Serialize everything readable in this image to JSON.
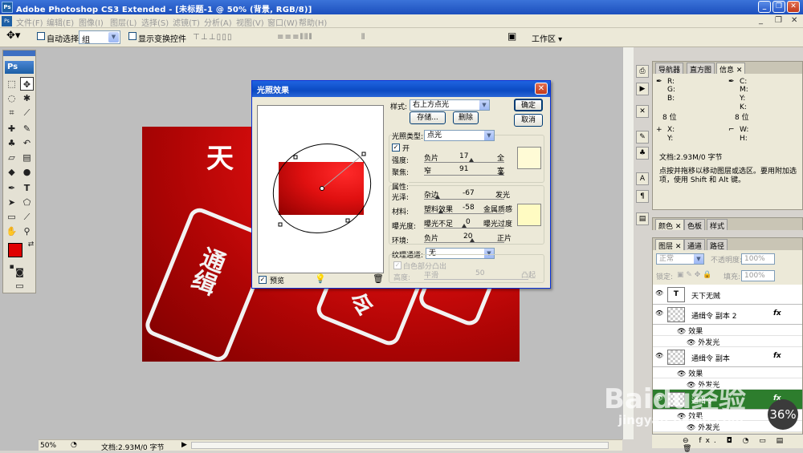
{
  "window": {
    "title": "Adobe Photoshop CS3 Extended - [未标题-1 @ 50% (背景, RGB/8)]",
    "app_icon": "Ps"
  },
  "menu": {
    "items": [
      "文件(F)",
      "编辑(E)",
      "图像(I)",
      "图层(L)",
      "选择(S)",
      "滤镜(T)",
      "分析(A)",
      "视图(V)",
      "窗口(W)",
      "帮助(H)"
    ]
  },
  "options": {
    "auto_select_label": "自动选择:",
    "auto_select_value": "组",
    "show_transform_label": "显示变换控件",
    "workspace_label": "工作区 ▾"
  },
  "toolbox": {
    "logo": "Ps"
  },
  "canvas": {
    "text_top": "天",
    "stamp_text_1": "通缉",
    "stamp_text_2": "令"
  },
  "status": {
    "zoom": "50%",
    "doc": "文档:2.93M/0 字节"
  },
  "dialog": {
    "title": "光照效果",
    "style_label": "样式:",
    "style_value": "右上方点光",
    "save_button": "存储...",
    "delete_button": "删除",
    "ok_button": "确定",
    "cancel_button": "取消",
    "light_type_label": "光照类型:",
    "light_type_value": "点光",
    "on_label": "开",
    "intensity": {
      "label": "强度:",
      "left": "负片",
      "value": "17",
      "right": "全"
    },
    "focus": {
      "label": "聚焦:",
      "left": "窄",
      "value": "91",
      "right": "宽"
    },
    "properties_label": "属性:",
    "gloss": {
      "label": "光泽:",
      "left": "杂边",
      "value": "-67",
      "right": "发光"
    },
    "material": {
      "label": "材料:",
      "left": "塑料效果",
      "value": "-58",
      "right": "金属质感"
    },
    "exposure": {
      "label": "曝光度:",
      "left": "曝光不足",
      "value": "0",
      "right": "曝光过度"
    },
    "ambience": {
      "label": "环境:",
      "left": "负片",
      "value": "20",
      "right": "正片"
    },
    "texture_label": "纹理通道:",
    "texture_value": "无",
    "white_high_label": "白色部分凸出",
    "height": {
      "label": "高度:",
      "left": "平滑",
      "value": "50",
      "right": "凸起"
    },
    "preview_label": "预览"
  },
  "navigator": {
    "tabs": [
      "导航器",
      "直方图",
      "信息"
    ],
    "rgb": [
      "R:",
      "G:",
      "B:"
    ],
    "cmyk": [
      "C:",
      "M:",
      "Y:",
      "K:"
    ],
    "bits_left": "8 位",
    "bits_right": "8 位",
    "xy": [
      "X:",
      "Y:"
    ],
    "wh": [
      "W:",
      "H:"
    ],
    "doc": "文档:2.93M/0 字节",
    "hint": "点按并拖移以移动图层或选区。要用附加选项，使用 Shift 和 Alt 键。"
  },
  "color_panel": {
    "tabs": [
      "颜色",
      "色板",
      "样式"
    ]
  },
  "layers_panel": {
    "tabs": [
      "图层",
      "通道",
      "路径"
    ],
    "blend_mode": "正常",
    "opacity_label": "不透明度:",
    "opacity_value": "100%",
    "lock_label": "锁定:",
    "fill_label": "填充:",
    "fill_value": "100%",
    "layers": [
      {
        "name": "天下无贼",
        "type": "text"
      },
      {
        "name": "通缉令 副本 2",
        "fx": "fx"
      },
      {
        "name": "通缉令 副本",
        "fx": "fx"
      },
      {
        "name": "通缉令",
        "fx": "fx"
      }
    ],
    "effect_label": "效果",
    "outer_glow_label": "外发光",
    "layer_icons": "⊖ fx. ◘ ◔ ▭ ▤ 🗑"
  },
  "watermark": {
    "text": "Baidu经验",
    "url": "jingyan.baidu.com",
    "badge": "36%"
  },
  "colors": {
    "foreground": "#e00000",
    "background": "#ffffff",
    "accent": "#0a246a"
  }
}
